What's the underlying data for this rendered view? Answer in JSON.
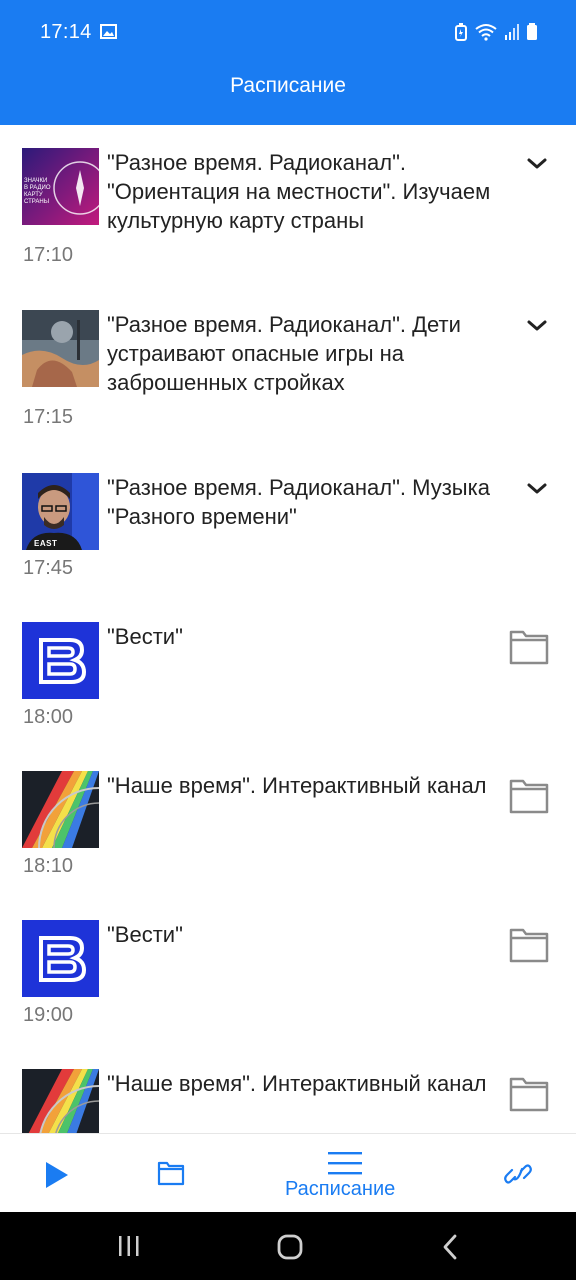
{
  "status_bar": {
    "time": "17:14"
  },
  "header": {
    "title": "Расписание"
  },
  "schedule": [
    {
      "title": "\"Разное время. Радиоканал\". \"Ориентация на местности\". Изучаем культурную карту страны",
      "time": "17:10",
      "action": "chevron-down-icon",
      "thumb_text": [
        "ЗНАЧКИ",
        "В РАДИО",
        "КАРТУ",
        "СТРАНЫ"
      ]
    },
    {
      "title": "\"Разное время. Радиоканал\". Дети устраивают опасные игры на заброшенных стройках",
      "time": "17:15",
      "action": "chevron-down-icon"
    },
    {
      "title": "\"Разное время. Радиоканал\". Музыка \"Разного времени\"",
      "time": "17:45",
      "action": "chevron-down-icon",
      "thumb_text": [
        "EAST"
      ]
    },
    {
      "title": "\"Вести\"",
      "time": "18:00",
      "action": "folder-icon"
    },
    {
      "title": "\"Наше время\". Интерактивный канал",
      "time": "18:10",
      "action": "folder-icon"
    },
    {
      "title": "\"Вести\"",
      "time": "19:00",
      "action": "folder-icon"
    },
    {
      "title": "\"Наше время\". Интерактивный канал",
      "time": "",
      "action": "folder-icon"
    }
  ],
  "bottom_nav": {
    "items": [
      {
        "icon": "play-icon",
        "label": ""
      },
      {
        "icon": "folder-icon",
        "label": ""
      },
      {
        "icon": "schedule-list-icon",
        "label": "Расписание",
        "active": true
      },
      {
        "icon": "link-icon",
        "label": ""
      }
    ]
  },
  "colors": {
    "accent": "#1a7cf2",
    "vesti_blue": "#1e33d8",
    "icon_gray": "#8a8a8a"
  }
}
